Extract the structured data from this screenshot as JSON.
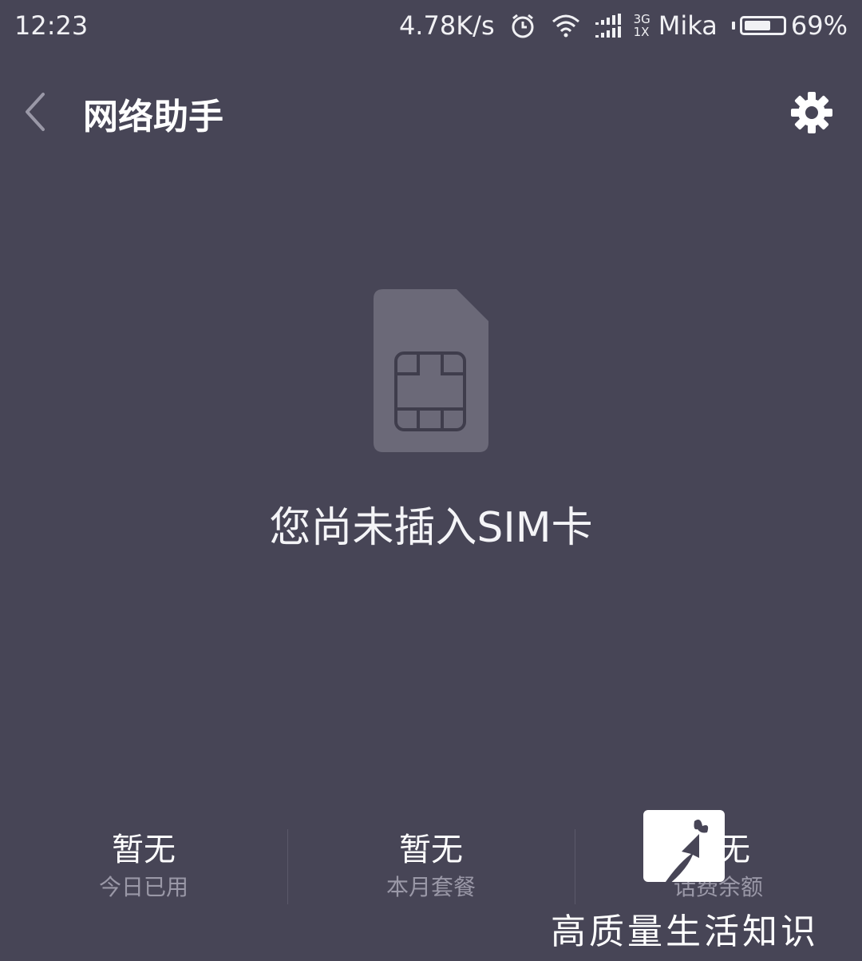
{
  "status_bar": {
    "time": "12:23",
    "net_speed": "4.78K/s",
    "net_type_top": "3G",
    "net_type_bottom": "1X",
    "carrier": "Mika",
    "battery_percent": "69%",
    "battery_level": 0.69,
    "icons": [
      "alarm-icon",
      "wifi-icon",
      "signal-icon",
      "battery-icon"
    ]
  },
  "header": {
    "title": "网络助手",
    "back_icon": "chevron-left-icon",
    "settings_icon": "gear-icon"
  },
  "main": {
    "illustration_icon": "sim-card-icon",
    "message": "您尚未插入SIM卡"
  },
  "stats": [
    {
      "value": "暂无",
      "label": "今日已用"
    },
    {
      "value": "暂无",
      "label": "本月套餐"
    },
    {
      "value": "暂无",
      "label": "话费余额"
    }
  ],
  "watermark": {
    "text": "高质量生活知识"
  },
  "colors": {
    "background": "#474556",
    "sim_card": "#6b6978",
    "label": "#9a98a7"
  }
}
